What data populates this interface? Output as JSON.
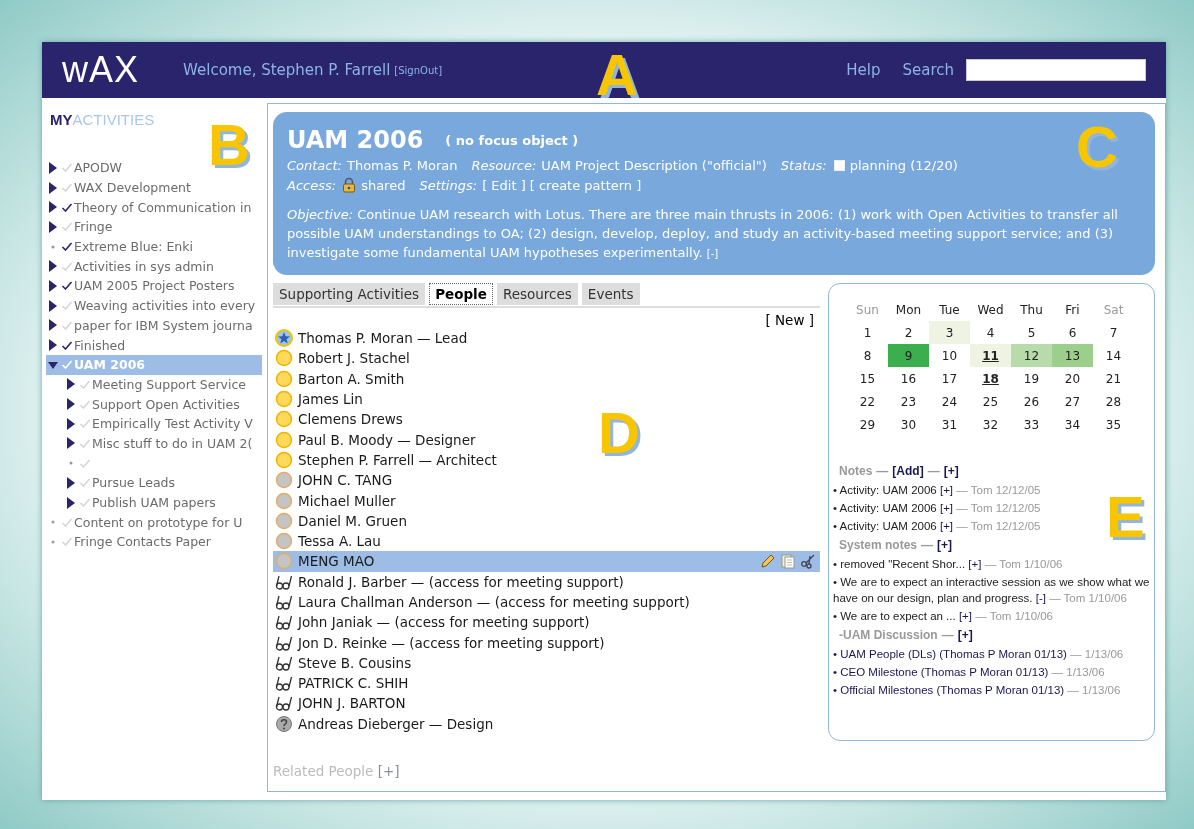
{
  "header": {
    "logo": "wAX",
    "welcome": "Welcome, Stephen P. Farrell",
    "signout": "[SignOut]",
    "links": [
      "Help",
      "Search"
    ]
  },
  "callouts": [
    "A",
    "B",
    "C",
    "D",
    "E"
  ],
  "sidebar": {
    "title_prefix": "MY",
    "title": "ACTIVITIES",
    "items": [
      {
        "label": "APODW",
        "kind": "collapsed",
        "checked": false,
        "selected": false
      },
      {
        "label": "WAX Development",
        "kind": "collapsed",
        "checked": false,
        "selected": false
      },
      {
        "label": "Theory of Communication in",
        "kind": "collapsed",
        "checked": true,
        "selected": false
      },
      {
        "label": "Fringe",
        "kind": "collapsed",
        "checked": false,
        "selected": false
      },
      {
        "label": "Extreme Blue: Enki",
        "kind": "leaf",
        "checked": true,
        "selected": false
      },
      {
        "label": "Activities in sys admin",
        "kind": "collapsed",
        "checked": false,
        "selected": false
      },
      {
        "label": "UAM 2005 Project Posters",
        "kind": "collapsed",
        "checked": true,
        "selected": false
      },
      {
        "label": "Weaving activities into every",
        "kind": "collapsed",
        "checked": false,
        "selected": false
      },
      {
        "label": "paper for IBM System journa",
        "kind": "collapsed",
        "checked": false,
        "selected": false
      },
      {
        "label": "Finished",
        "kind": "collapsed",
        "checked": true,
        "selected": false
      },
      {
        "label": "UAM 2006",
        "kind": "expanded",
        "checked": true,
        "selected": true,
        "children": [
          {
            "label": "Meeting Support Service",
            "kind": "collapsed",
            "checked": false,
            "selected": false
          },
          {
            "label": "Support Open Activities",
            "kind": "collapsed",
            "checked": false,
            "selected": false
          },
          {
            "label": "Empirically Test Activity V",
            "kind": "collapsed",
            "checked": false,
            "selected": false
          },
          {
            "label": "Misc stuff to do in UAM 2(",
            "kind": "collapsed",
            "checked": false,
            "selected": false
          },
          {
            "kind": "leaf",
            "checked": false,
            "selected": false
          },
          {
            "label": "Pursue Leads",
            "kind": "collapsed",
            "checked": false,
            "selected": false
          },
          {
            "label": "Publish UAM papers",
            "kind": "collapsed",
            "checked": false,
            "selected": false
          }
        ]
      },
      {
        "label": "Content on prototype for U",
        "kind": "leaf",
        "checked": false,
        "selected": false
      },
      {
        "label": "Fringe Contacts Paper",
        "kind": "leaf",
        "checked": false,
        "selected": false
      }
    ]
  },
  "activity": {
    "title": "UAM 2006",
    "focus": "( no focus object )",
    "contact_label": "Contact:",
    "contact": "Thomas P. Moran",
    "resource_label": "Resource:",
    "resource": "UAM Project Description (\"official\")",
    "status_label": "Status:",
    "status_checked": false,
    "status": "planning (12/20)",
    "access_label": "Access:",
    "access": "shared",
    "settings_label": "Settings:",
    "settings_links": [
      "[ Edit ]",
      "[ create pattern ]"
    ],
    "objective_label": "Objective:",
    "objective": "Continue UAM research with Lotus. There are three main thrusts in 2006: (1) work with Open Activities to transfer all possible UAM understandings to OA; (2) design, develop, deploy, and study an activity-based meeting support service; and (3) investigate some fundamental UAM hypotheses experimentally.",
    "collapse": "[-]"
  },
  "tabs": [
    {
      "label": "Supporting Activities",
      "selected": false
    },
    {
      "label": "People",
      "selected": true
    },
    {
      "label": "Resources",
      "selected": false
    },
    {
      "label": "Events",
      "selected": false
    }
  ],
  "new_link": "[ New ]",
  "people": [
    {
      "name": "Thomas P. Moran — Lead",
      "kind": "lead",
      "selected": false
    },
    {
      "name": "Robert J. Stachel",
      "kind": "member",
      "selected": false
    },
    {
      "name": "Barton A. Smith",
      "kind": "member",
      "selected": false
    },
    {
      "name": "James Lin",
      "kind": "member",
      "selected": false
    },
    {
      "name": "Clemens Drews",
      "kind": "member",
      "selected": false
    },
    {
      "name": "Paul B. Moody — Designer",
      "kind": "member",
      "selected": false
    },
    {
      "name": "Stephen P. Farrell — Architect",
      "kind": "member",
      "selected": false
    },
    {
      "name": "JOHN C. TANG",
      "kind": "guest",
      "selected": false
    },
    {
      "name": "Michael Muller",
      "kind": "guest",
      "selected": false
    },
    {
      "name": "Daniel M. Gruen",
      "kind": "guest",
      "selected": false
    },
    {
      "name": "Tessa A. Lau",
      "kind": "guest",
      "selected": false
    },
    {
      "name": "MENG MAO",
      "kind": "guest",
      "selected": true
    },
    {
      "name": "Ronald J. Barber — (access for meeting support)",
      "kind": "reader",
      "selected": false
    },
    {
      "name": "Laura Challman Anderson — (access for meeting support)",
      "kind": "reader",
      "selected": false
    },
    {
      "name": "John Janiak — (access for meeting support)",
      "kind": "reader",
      "selected": false
    },
    {
      "name": "Jon D. Reinke — (access for meeting support)",
      "kind": "reader",
      "selected": false
    },
    {
      "name": "Steve B. Cousins",
      "kind": "reader",
      "selected": false
    },
    {
      "name": "PATRICK C. SHIH",
      "kind": "reader",
      "selected": false
    },
    {
      "name": "JOHN J. BARTON",
      "kind": "reader",
      "selected": false
    },
    {
      "name": "Andreas Dieberger — Design",
      "kind": "unknown",
      "selected": false
    }
  ],
  "related": {
    "label": "Related People",
    "link": "[+]"
  },
  "calendar": {
    "days": [
      {
        "label": "Sun",
        "dimmed": true
      },
      {
        "label": "Mon",
        "dimmed": false
      },
      {
        "label": "Tue",
        "dimmed": false
      },
      {
        "label": "Wed",
        "dimmed": false
      },
      {
        "label": "Thu",
        "dimmed": false
      },
      {
        "label": "Fri",
        "dimmed": false
      },
      {
        "label": "Sat",
        "dimmed": true
      }
    ],
    "weeks": [
      [
        {
          "day": "1",
          "underlined": false
        },
        {
          "day": "2",
          "underlined": false
        },
        {
          "day": "3",
          "underlined": false,
          "color": "#eef3e2"
        },
        {
          "day": "4",
          "underlined": false
        },
        {
          "day": "5",
          "underlined": false
        },
        {
          "day": "6",
          "underlined": false
        },
        {
          "day": "7",
          "underlined": false
        }
      ],
      [
        {
          "day": "8",
          "underlined": false
        },
        {
          "day": "9",
          "underlined": false,
          "color": "#3bae4e"
        },
        {
          "day": "10",
          "underlined": false
        },
        {
          "day": "11",
          "underlined": true,
          "color": "#eef3e2"
        },
        {
          "day": "12",
          "underlined": false,
          "color": "#b7dcaa"
        },
        {
          "day": "13",
          "underlined": false,
          "color": "#9ccf8c"
        },
        {
          "day": "14",
          "underlined": false
        }
      ],
      [
        {
          "day": "15",
          "underlined": false
        },
        {
          "day": "16",
          "underlined": false
        },
        {
          "day": "17",
          "underlined": false
        },
        {
          "day": "18",
          "underlined": true
        },
        {
          "day": "19",
          "underlined": false
        },
        {
          "day": "20",
          "underlined": false
        },
        {
          "day": "21",
          "underlined": false
        }
      ],
      [
        {
          "day": "22",
          "underlined": false
        },
        {
          "day": "23",
          "underlined": false
        },
        {
          "day": "24",
          "underlined": false
        },
        {
          "day": "25",
          "underlined": false
        },
        {
          "day": "26",
          "underlined": false
        },
        {
          "day": "27",
          "underlined": false
        },
        {
          "day": "28",
          "underlined": false
        }
      ],
      [
        {
          "day": "29",
          "underlined": false
        },
        {
          "day": "30",
          "underlined": false
        },
        {
          "day": "31",
          "underlined": false
        },
        {
          "day": "32",
          "underlined": false
        },
        {
          "day": "33",
          "underlined": false
        },
        {
          "day": "34",
          "underlined": false
        },
        {
          "day": "35",
          "underlined": false
        }
      ]
    ]
  },
  "notes": [
    {
      "heading": [
        {
          "text": "Notes",
          "kind": "label"
        },
        {
          "text": "—",
          "kind": "sep"
        },
        {
          "text": "[Add]",
          "kind": "link"
        },
        {
          "text": "—",
          "kind": "sep"
        },
        {
          "text": "[+]",
          "kind": "link"
        }
      ],
      "entries": [
        {
          "text": "• Activity: UAM 2006",
          "kind": "note",
          "link": "[+]",
          "meta": "— Tom 12/12/05"
        },
        {
          "text": "• Activity: UAM 2006",
          "kind": "note",
          "link": "[+]",
          "meta": "— Tom 12/12/05"
        },
        {
          "text": "• Activity: UAM 2006",
          "kind": "note",
          "link": "[+]",
          "meta": "— Tom 12/12/05"
        }
      ]
    },
    {
      "heading": [
        {
          "text": "System notes",
          "kind": "label"
        },
        {
          "text": "—",
          "kind": "sep"
        },
        {
          "text": "[+]",
          "kind": "link"
        }
      ],
      "entries": [
        {
          "text": "• removed \"Recent Shor...",
          "kind": "note",
          "link": "[+]",
          "meta": "— Tom 1/10/06"
        },
        {
          "text": "• We are to expect an interactive session as we show what we have on our design, plan and progress.",
          "kind": "note",
          "link": "[-]",
          "meta": "— Tom 1/10/06"
        },
        {
          "text": "• We are to expect an ...",
          "kind": "note",
          "link": "[+]",
          "meta": "— Tom 1/10/06"
        }
      ]
    },
    {
      "heading": [
        {
          "text": "-UAM Discussion",
          "kind": "label"
        },
        {
          "text": "—",
          "kind": "sep"
        },
        {
          "text": "[+]",
          "kind": "link"
        }
      ],
      "entries": [
        {
          "text": "• UAM People (DLs) (Thomas P Moran 01/13)",
          "kind": "post",
          "meta": "— 1/13/06"
        },
        {
          "text": "• CEO Milestone (Thomas P Moran 01/13)",
          "kind": "post",
          "meta": "— 1/13/06"
        },
        {
          "text": "• Official Milestones (Thomas P Moran 01/13)",
          "kind": "post",
          "meta": "— 1/13/06"
        }
      ]
    }
  ]
}
